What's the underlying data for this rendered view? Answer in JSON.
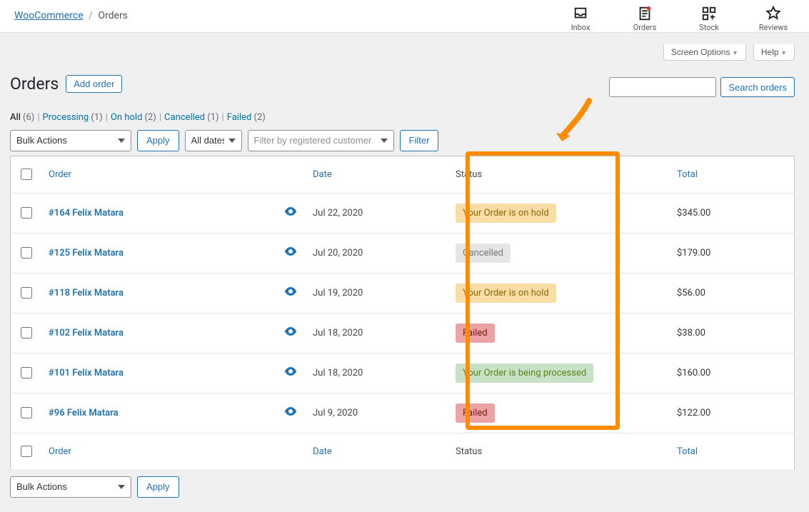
{
  "breadcrumb": {
    "root": "WooCommerce",
    "page": "Orders"
  },
  "top_icons": [
    {
      "key": "inbox",
      "label": "Inbox"
    },
    {
      "key": "orders",
      "label": "Orders"
    },
    {
      "key": "stock",
      "label": "Stock"
    },
    {
      "key": "reviews",
      "label": "Reviews"
    }
  ],
  "screen_meta": {
    "screen_options": "Screen Options",
    "help": "Help"
  },
  "page_title": "Orders",
  "page_action": "Add order",
  "search": {
    "placeholder": "",
    "button": "Search orders"
  },
  "status_filters": [
    {
      "label": "All",
      "count": "(6)",
      "current": true,
      "link": false
    },
    {
      "label": "Processing",
      "count": "(1)",
      "current": false,
      "link": true
    },
    {
      "label": "On hold",
      "count": "(2)",
      "current": false,
      "link": true
    },
    {
      "label": "Cancelled",
      "count": "(1)",
      "current": false,
      "link": true
    },
    {
      "label": "Failed",
      "count": "(2)",
      "current": false,
      "link": true
    }
  ],
  "actions": {
    "bulk_label": "Bulk Actions",
    "apply": "Apply",
    "dates": "All dates",
    "customer_placeholder": "Filter by registered customer",
    "filter": "Filter"
  },
  "columns": {
    "order": "Order",
    "date": "Date",
    "status": "Status",
    "total": "Total"
  },
  "orders": [
    {
      "id": "#164 Felix Matara",
      "date": "Jul 22, 2020",
      "status": "Your Order is on hold",
      "status_class": "pill-onhold",
      "total": "$345.00"
    },
    {
      "id": "#125 Felix Matara",
      "date": "Jul 20, 2020",
      "status": "Cancelled",
      "status_class": "pill-cancelled",
      "total": "$179.00"
    },
    {
      "id": "#118 Felix Matara",
      "date": "Jul 19, 2020",
      "status": "Your Order is on hold",
      "status_class": "pill-onhold",
      "total": "$56.00"
    },
    {
      "id": "#102 Felix Matara",
      "date": "Jul 18, 2020",
      "status": "Failed",
      "status_class": "pill-failed",
      "total": "$38.00"
    },
    {
      "id": "#101 Felix Matara",
      "date": "Jul 18, 2020",
      "status": "Your Order is being processed",
      "status_class": "pill-processing",
      "total": "$160.00"
    },
    {
      "id": "#96 Felix Matara",
      "date": "Jul 9, 2020",
      "status": "Failed",
      "status_class": "pill-failed",
      "total": "$122.00"
    }
  ]
}
